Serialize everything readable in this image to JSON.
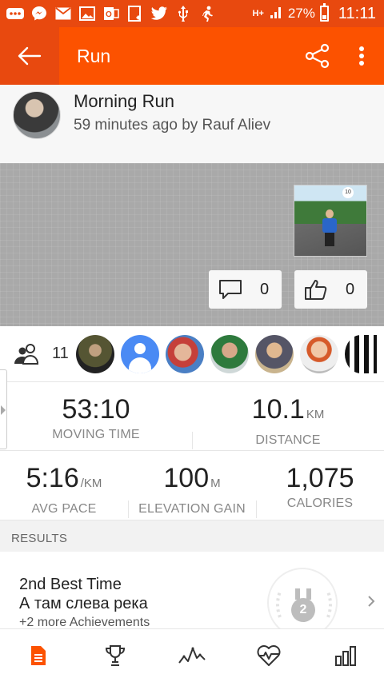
{
  "status_bar": {
    "battery_text": "27%",
    "time": "11:11",
    "network": "H+",
    "icons": [
      "more-icon",
      "messenger-icon",
      "mail-icon",
      "image-icon",
      "office-icon",
      "tasks-icon",
      "twitter-icon",
      "usb-icon",
      "run-icon"
    ]
  },
  "app_bar": {
    "title": "Run",
    "background": "#fc5200"
  },
  "activity": {
    "title": "Morning Run",
    "subtitle": "59 minutes ago by Rauf Aliev"
  },
  "social": {
    "comments": "0",
    "kudos": "0"
  },
  "athletes": {
    "count": "11"
  },
  "stats": {
    "moving_time": {
      "value": "53:10",
      "label": "MOVING TIME"
    },
    "distance": {
      "value": "10.1",
      "unit": "KM",
      "label": "DISTANCE"
    },
    "avg_pace": {
      "value": "5:16",
      "unit": "/KM",
      "label": "AVG PACE"
    },
    "elevation_gain": {
      "value": "100",
      "unit": "M",
      "label": "ELEVATION GAIN"
    },
    "calories": {
      "value": "1,075",
      "label": "CALORIES"
    }
  },
  "results": {
    "header": "RESULTS",
    "achievement_title": "2nd Best Time",
    "segment_name": "А там слева река",
    "more": "+2 more Achievements",
    "medal_rank": "2"
  },
  "bottom_nav": {
    "items": [
      "overview-icon",
      "trophy-icon",
      "analysis-icon",
      "heart-rate-icon",
      "splits-icon"
    ],
    "active_color": "#fc5200"
  }
}
